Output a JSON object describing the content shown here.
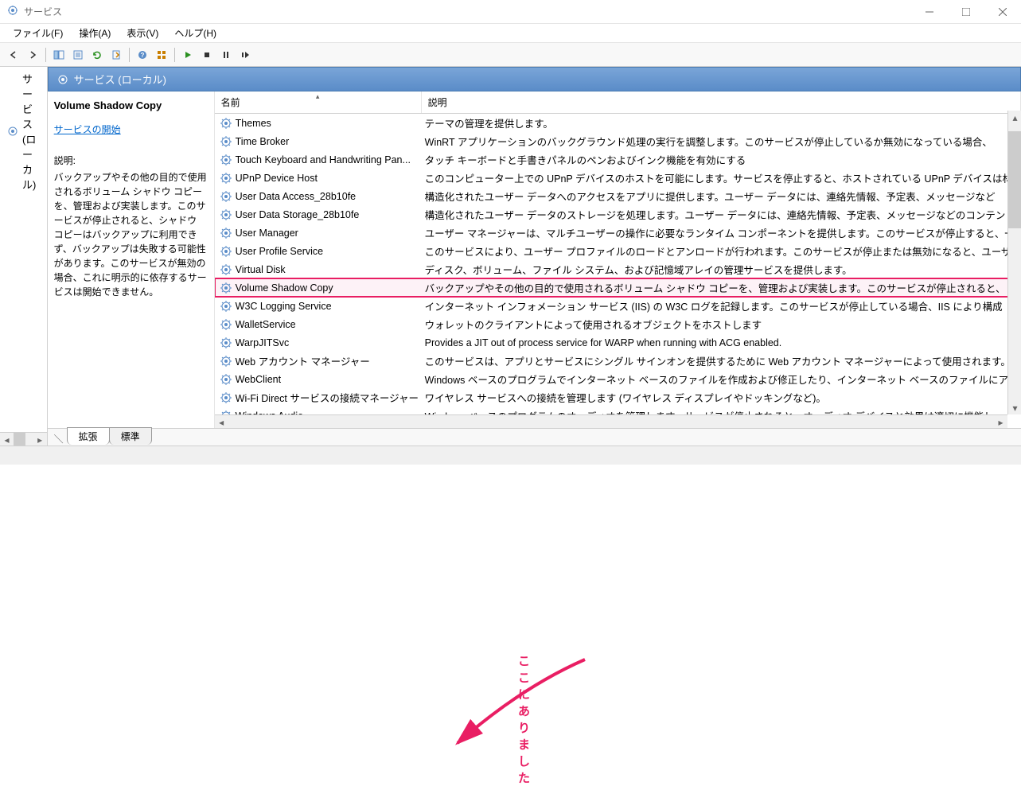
{
  "window": {
    "title": "サービス"
  },
  "menu": {
    "file": "ファイル(F)",
    "action": "操作(A)",
    "view": "表示(V)",
    "help": "ヘルプ(H)"
  },
  "tree": {
    "node": "サービス (ローカル)"
  },
  "content_header": "サービス (ローカル)",
  "detail": {
    "title": "Volume Shadow Copy",
    "start_link": "サービスの開始",
    "desc_label": "説明:",
    "desc_text": "バックアップやその他の目的で使用されるボリューム シャドウ コピーを、管理および実装します。このサービスが停止されると、シャドウ コピーはバックアップに利用できず、バックアップは失敗する可能性があります。このサービスが無効の場合、これに明示的に依存するサービスは開始できません。"
  },
  "columns": {
    "name": "名前",
    "description": "説明"
  },
  "services": [
    {
      "name": "Themes",
      "desc": "テーマの管理を提供します。"
    },
    {
      "name": "Time Broker",
      "desc": "WinRT アプリケーションのバックグラウンド処理の実行を調整します。このサービスが停止しているか無効になっている場合、"
    },
    {
      "name": "Touch Keyboard and Handwriting Pan...",
      "desc": "タッチ キーボードと手書きパネルのペンおよびインク機能を有効にする"
    },
    {
      "name": "UPnP Device Host",
      "desc": "このコンピューター上での UPnP デバイスのホストを可能にします。サービスを停止すると、ホストされている UPnP デバイスは材"
    },
    {
      "name": "User Data Access_28b10fe",
      "desc": "構造化されたユーザー データへのアクセスをアプリに提供します。ユーザー データには、連絡先情報、予定表、メッセージなど"
    },
    {
      "name": "User Data Storage_28b10fe",
      "desc": "構造化されたユーザー データのストレージを処理します。ユーザー データには、連絡先情報、予定表、メッセージなどのコンテン"
    },
    {
      "name": "User Manager",
      "desc": "ユーザー マネージャーは、マルチユーザーの操作に必要なランタイム コンポーネントを提供します。このサービスが停止すると、一"
    },
    {
      "name": "User Profile Service",
      "desc": "このサービスにより、ユーザー プロファイルのロードとアンロードが行われます。このサービスが停止または無効になると、ユーザー"
    },
    {
      "name": "Virtual Disk",
      "desc": "ディスク、ボリューム、ファイル システム、および記憶域アレイの管理サービスを提供します。"
    },
    {
      "name": "Volume Shadow Copy",
      "desc": "バックアップやその他の目的で使用されるボリューム シャドウ コピーを、管理および実装します。このサービスが停止されると、",
      "highlighted": true
    },
    {
      "name": "W3C Logging Service",
      "desc": "インターネット インフォメーション サービス (IIS) の W3C ログを記録します。このサービスが停止している場合、IIS により構成"
    },
    {
      "name": "WalletService",
      "desc": "ウォレットのクライアントによって使用されるオブジェクトをホストします"
    },
    {
      "name": "WarpJITSvc",
      "desc": "Provides a JIT out of process service for WARP when running with ACG enabled."
    },
    {
      "name": "Web アカウント マネージャー",
      "desc": "このサービスは、アプリとサービスにシングル サインオンを提供するために Web アカウント マネージャーによって使用されます。"
    },
    {
      "name": "WebClient",
      "desc": "Windows ベースのプログラムでインターネット ベースのファイルを作成および修正したり、インターネット ベースのファイルにア"
    },
    {
      "name": "Wi-Fi Direct サービスの接続マネージャー サ...",
      "desc": "ワイヤレス サービスへの接続を管理します (ワイヤレス ディスプレイやドッキングなど)。"
    },
    {
      "name": "Windows Audio",
      "desc": "Windows ベースのプログラムのオーディオを管理します。サービスが停止されると、オーディオ デバイスと効果は適切に機能し"
    }
  ],
  "tabs": {
    "extended": "拡張",
    "standard": "標準"
  },
  "annotation": {
    "text": "ここにありました"
  }
}
